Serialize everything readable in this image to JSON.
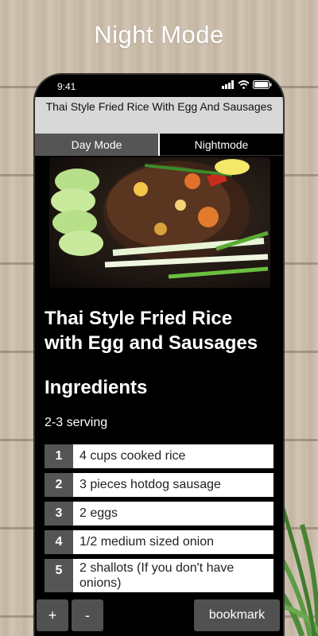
{
  "headline": "Night Mode",
  "status": {
    "time": "9:41"
  },
  "header": {
    "title": "Thai Style Fried Rice With Egg And Sausages"
  },
  "mode_tabs": {
    "day": "Day Mode",
    "night": "Nightmode"
  },
  "recipe": {
    "title": "Thai Style Fried Rice with Egg and Sausages",
    "ingredients_heading": "Ingredients",
    "servings": "2-3 serving",
    "ingredients": [
      {
        "num": "1",
        "text": "4 cups cooked rice"
      },
      {
        "num": "2",
        "text": "3 pieces hotdog sausage"
      },
      {
        "num": "3",
        "text": "2 eggs"
      },
      {
        "num": "4",
        "text": "1/2 medium sized onion"
      },
      {
        "num": "5",
        "text": "2 shallots (If you don't have onions)"
      }
    ]
  },
  "controls": {
    "plus": "+",
    "minus": "-",
    "bookmark": "bookmark"
  },
  "colors": {
    "title_bar": "#d8d8d8",
    "tab_active": "#555555",
    "background": "#000000"
  }
}
